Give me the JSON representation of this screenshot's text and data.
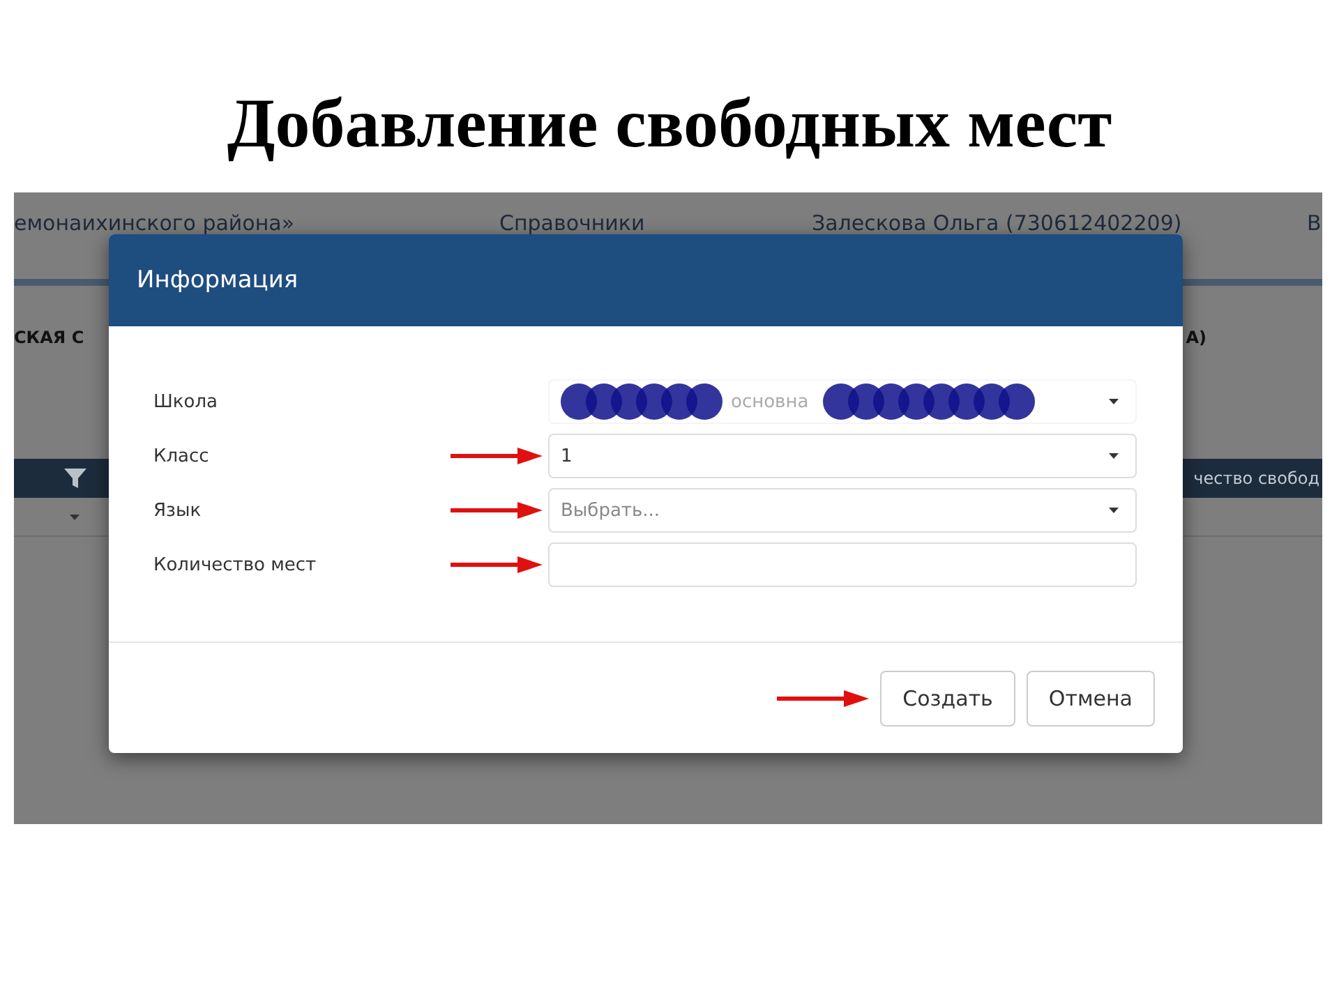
{
  "slide_title": "Добавление свободных мест",
  "background_app": {
    "top_bar": [
      "емонаихинского района»",
      "Справочники",
      "Залескова Ольга (730612402209)",
      "В"
    ],
    "section_row": [
      "СКАЯ С",
      "А)"
    ],
    "table_header": "чество свобод"
  },
  "dialog": {
    "title": "Информация",
    "fields": [
      {
        "label": "Школа",
        "kind": "redacted",
        "value": "основна",
        "annotated": false
      },
      {
        "label": "Класс",
        "kind": "select",
        "value": "1",
        "annotated": true
      },
      {
        "label": "Язык",
        "kind": "select",
        "placeholder": "Выбрать...",
        "annotated": true
      },
      {
        "label": "Количество мест",
        "kind": "text",
        "annotated": true
      }
    ],
    "buttons": [
      {
        "label": "Создать",
        "annotated": true
      },
      {
        "label": "Отмена",
        "annotated": false
      }
    ]
  }
}
